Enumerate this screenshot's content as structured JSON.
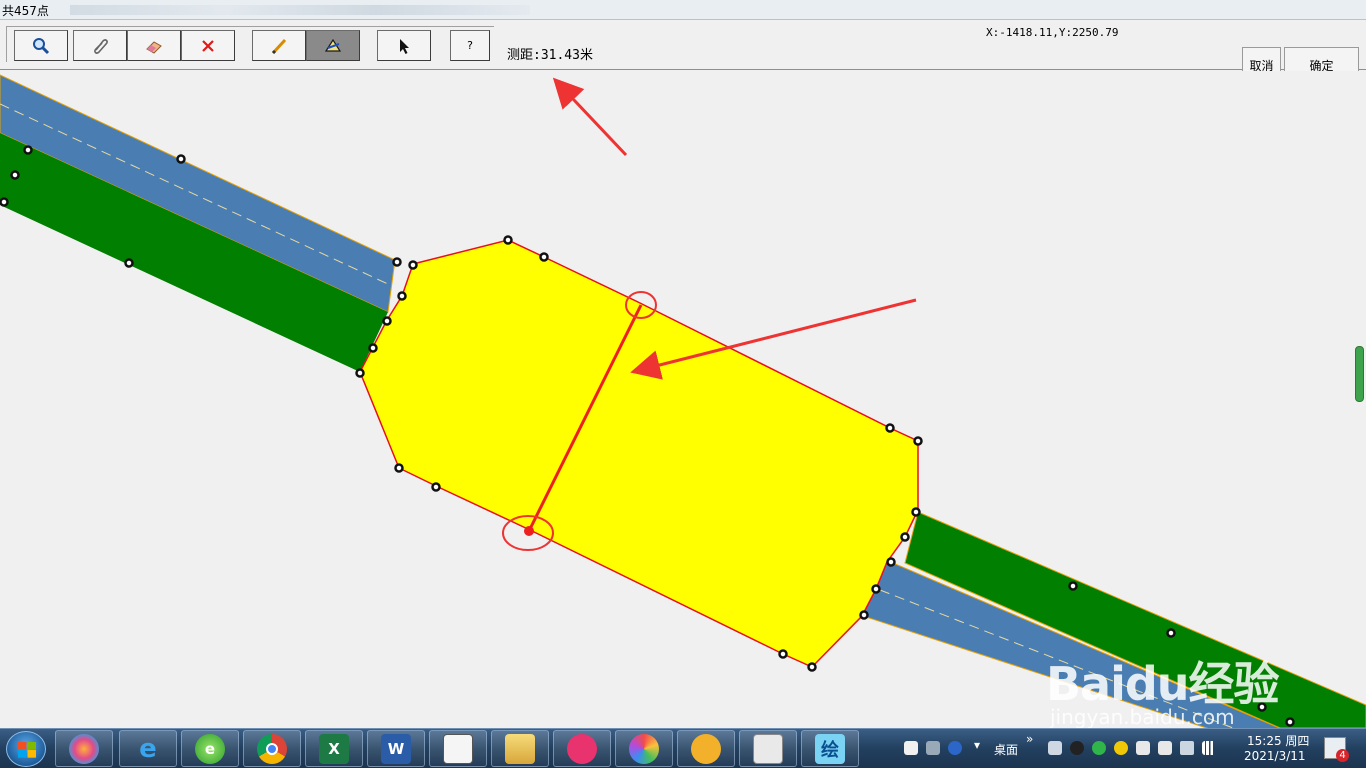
{
  "window": {
    "title": "共457点"
  },
  "toolbar": {
    "tools": [
      {
        "name": "zoom-tool",
        "icon": "magnifier-icon"
      },
      {
        "name": "pan-tool",
        "icon": "paperclip-icon"
      },
      {
        "name": "erase-tool",
        "icon": "eraser-icon"
      },
      {
        "name": "delete-tool",
        "icon": "red-x-icon"
      },
      {
        "name": "draw-tool",
        "icon": "pencil-icon"
      },
      {
        "name": "measure-tool",
        "icon": "measure-icon",
        "active": true
      },
      {
        "name": "select-tool",
        "icon": "arrow-cursor-icon"
      },
      {
        "name": "help-tool",
        "label": "?"
      }
    ],
    "measure_text": "测距:31.43米",
    "coords_text": "X:-1418.11,Y:2250.79",
    "cancel_label": "取消",
    "ok_label": "确定"
  },
  "watermark": {
    "logo": "Baidu经验",
    "url": "jingyan.baidu.com"
  },
  "taskbar": {
    "apps": [
      "windows-start",
      "baofeng",
      "ie",
      "browser-360",
      "chrome",
      "excel",
      "word",
      "reader",
      "explorer",
      "meitu",
      "image-viewer",
      "pen-app",
      "camera-app",
      "paint-app"
    ],
    "paint_app_label": "绘",
    "excel_label": "X",
    "word_label": "W",
    "desktop_label": "桌面",
    "expand_label": "»",
    "time": "15:25 周四",
    "date": "2021/3/11",
    "notification_count": "4"
  },
  "colors": {
    "polygon_fill": "#ffff00",
    "polygon_edge": "#e8101a",
    "road_blue": "#4a7eb3",
    "road_green": "#007f00",
    "annotation_red": "#ee3333"
  }
}
